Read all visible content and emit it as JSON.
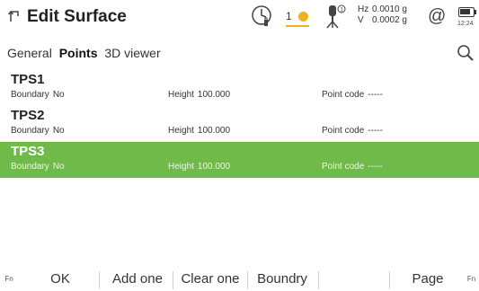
{
  "header": {
    "title": "Edit Surface",
    "satellite_count": "1",
    "precision_hz_label": "Hz",
    "precision_hz_value": "0.0010 g",
    "precision_v_label": "V",
    "precision_v_value": "0.0002 g",
    "at_symbol": "@",
    "clock": "12:24",
    "accent_color": "#f0b020"
  },
  "tabs": [
    {
      "label": "General"
    },
    {
      "label": "Points",
      "active": true
    },
    {
      "label": "3D viewer"
    }
  ],
  "points": [
    {
      "name": "TPS1",
      "boundary_label": "Boundary",
      "boundary_value": "No",
      "height_label": "Height",
      "height_value": "100.000",
      "code_label": "Point code",
      "code_value": "-----"
    },
    {
      "name": "TPS2",
      "boundary_label": "Boundary",
      "boundary_value": "No",
      "height_label": "Height",
      "height_value": "100.000",
      "code_label": "Point code",
      "code_value": "-----"
    },
    {
      "name": "TPS3",
      "boundary_label": "Boundary",
      "boundary_value": "No",
      "height_label": "Height",
      "height_value": "100.000",
      "code_label": "Point code",
      "code_value": "-----",
      "selected": true
    }
  ],
  "selection_color": "#6fba48",
  "function_bar": {
    "fn_left": "Fn",
    "ok": "OK",
    "add_one": "Add one",
    "clear_one": "Clear one",
    "boundry": "Boundry",
    "page": "Page",
    "fn_right": "Fn"
  }
}
